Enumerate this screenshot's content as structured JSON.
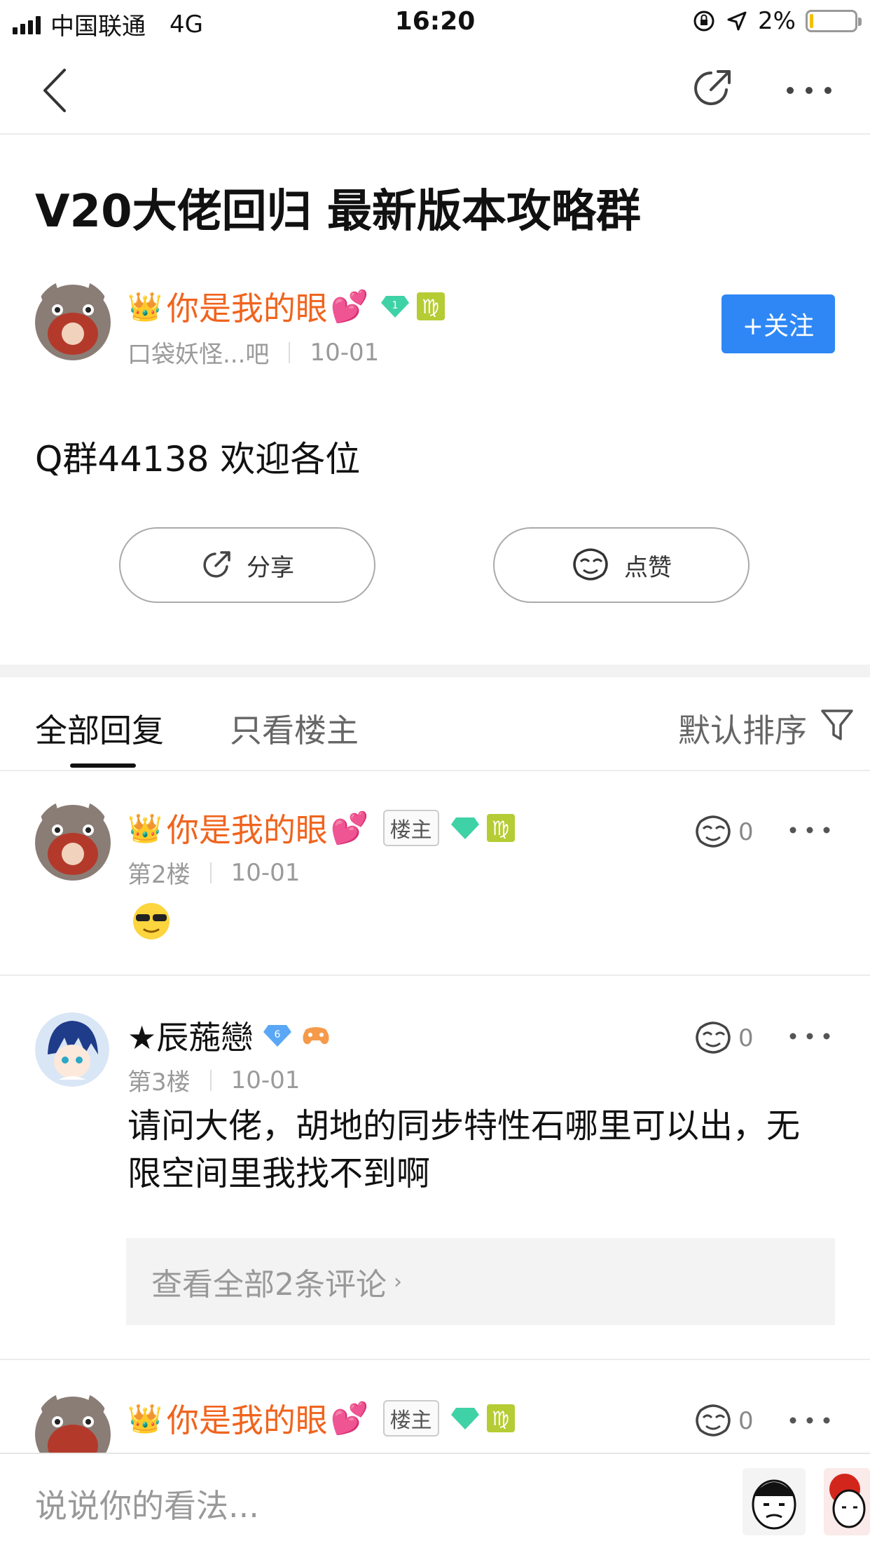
{
  "status": {
    "carrier": "中国联通",
    "network": "4G",
    "time": "16:20",
    "battery": "2%"
  },
  "post": {
    "title": "V20大佬回归 最新版本攻略群",
    "author": {
      "name": "你是我的眼",
      "level": "1",
      "forum": "口袋妖怪...吧",
      "date": "10-01"
    },
    "follow_label": "+关注",
    "body": "Q群44138 欢迎各位",
    "share_label": "分享",
    "like_label": "点赞"
  },
  "tabs": {
    "all": "全部回复",
    "owner_only": "只看楼主",
    "sort": "默认排序"
  },
  "replies": [
    {
      "name": "你是我的眼",
      "tag": "楼主",
      "floor": "第2楼",
      "date": "10-01",
      "likes": "0"
    },
    {
      "name": "★辰葹戀",
      "level": "6",
      "floor": "第3楼",
      "date": "10-01",
      "likes": "0",
      "text": "请问大佬，胡地的同步特性石哪里可以出，无限空间里我找不到啊",
      "comments_link": "查看全部2条评论"
    },
    {
      "name": "你是我的眼",
      "tag": "楼主",
      "likes": "0"
    }
  ],
  "bottom": {
    "placeholder": "说说你的看法..."
  },
  "colors": {
    "accent": "#2e87f5",
    "username": "#f0641e",
    "virgo_badge": "#b6cc34",
    "gem": "#3fd2a6"
  }
}
